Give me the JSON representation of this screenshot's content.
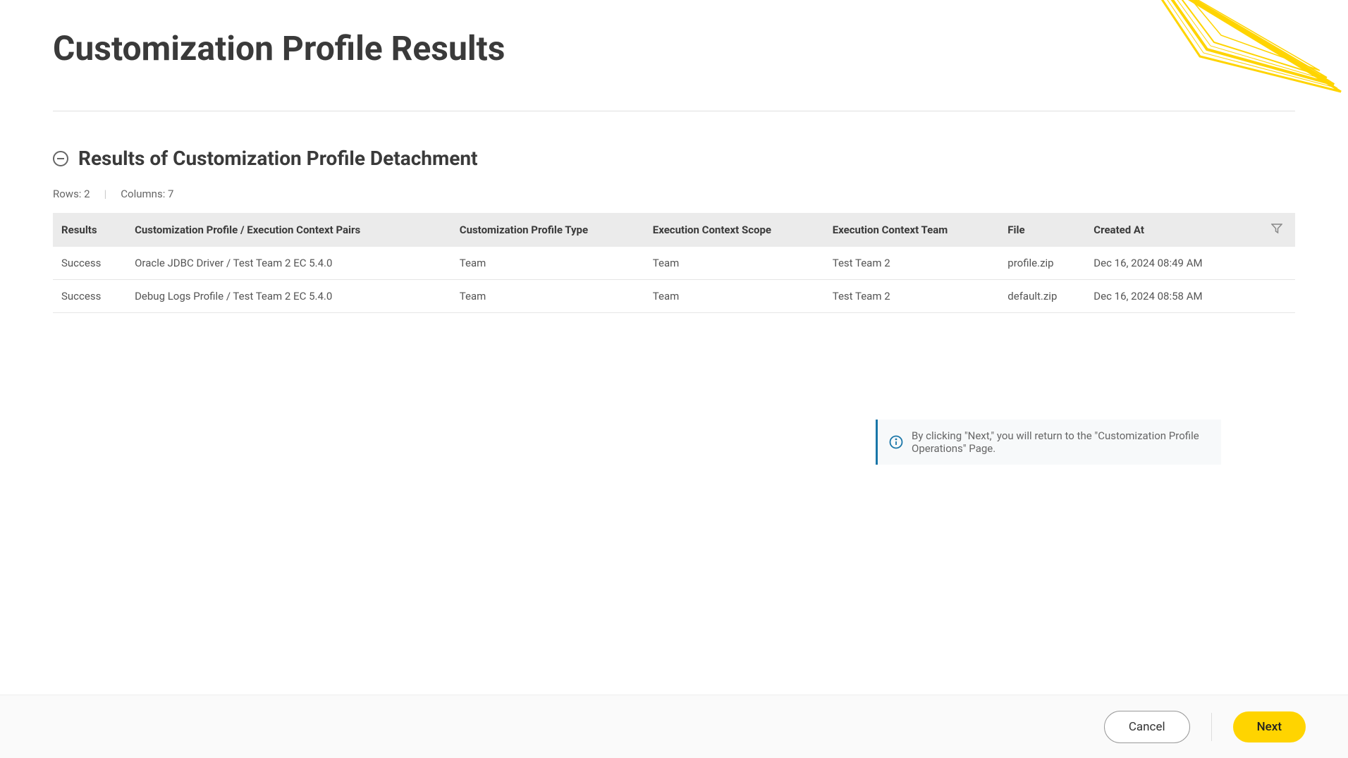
{
  "page_title": "Customization Profile Results",
  "section_title": "Results of Customization Profile Detachment",
  "meta": {
    "rows_label": "Rows: 2",
    "columns_label": "Columns: 7"
  },
  "columns": [
    "Results",
    "Customization Profile / Execution Context Pairs",
    "Customization Profile Type",
    "Execution Context Scope",
    "Execution Context Team",
    "File",
    "Created At"
  ],
  "rows": [
    {
      "result": "Success",
      "pair": "Oracle JDBC Driver / Test Team 2 EC 5.4.0",
      "profile_type": "Team",
      "scope": "Team",
      "team": "Test Team 2",
      "file": "profile.zip",
      "created": "Dec 16, 2024 08:49 AM"
    },
    {
      "result": "Success",
      "pair": "Debug Logs Profile / Test Team 2 EC 5.4.0",
      "profile_type": "Team",
      "scope": "Team",
      "team": "Test Team 2",
      "file": "default.zip",
      "created": "Dec 16, 2024 08:58 AM"
    }
  ],
  "info_text": "By clicking \"Next,\" you will return to the \"Customization Profile Operations\" Page.",
  "buttons": {
    "cancel": "Cancel",
    "next": "Next"
  }
}
